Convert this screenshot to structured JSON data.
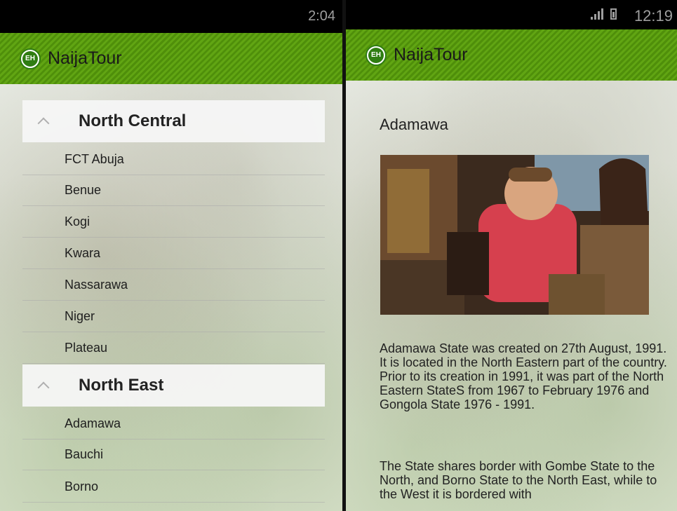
{
  "left_screen": {
    "status_time": "2:04",
    "app_title": "NaijaTour",
    "app_logo_text": "EH",
    "groups": [
      {
        "label": "North Central",
        "items": [
          "FCT Abuja",
          "Benue",
          "Kogi",
          "Kwara",
          "Nassarawa",
          "Niger",
          "Plateau"
        ]
      },
      {
        "label": "North East",
        "items": [
          "Adamawa",
          "Bauchi",
          "Borno"
        ]
      }
    ]
  },
  "right_screen": {
    "status_time": "12:19",
    "app_title": "NaijaTour",
    "app_logo_text": "EH",
    "detail_title": "Adamawa",
    "paragraphs": [
      "Adamawa State was created on 27th August, 1991. It is located in the North Eastern part of the country. Prior to its creation in 1991, it was part of the North Eastern StateS from 1967 to February 1976 and Gongola State 1976 - 1991.",
      " The State shares border with Gombe State to the North, and Borno State to the North East, while to the West it is bordered with"
    ]
  },
  "colors": {
    "action_bar": "#5a9d12",
    "status_bar": "#000000",
    "group_header_bg": "#f6f6f6"
  }
}
